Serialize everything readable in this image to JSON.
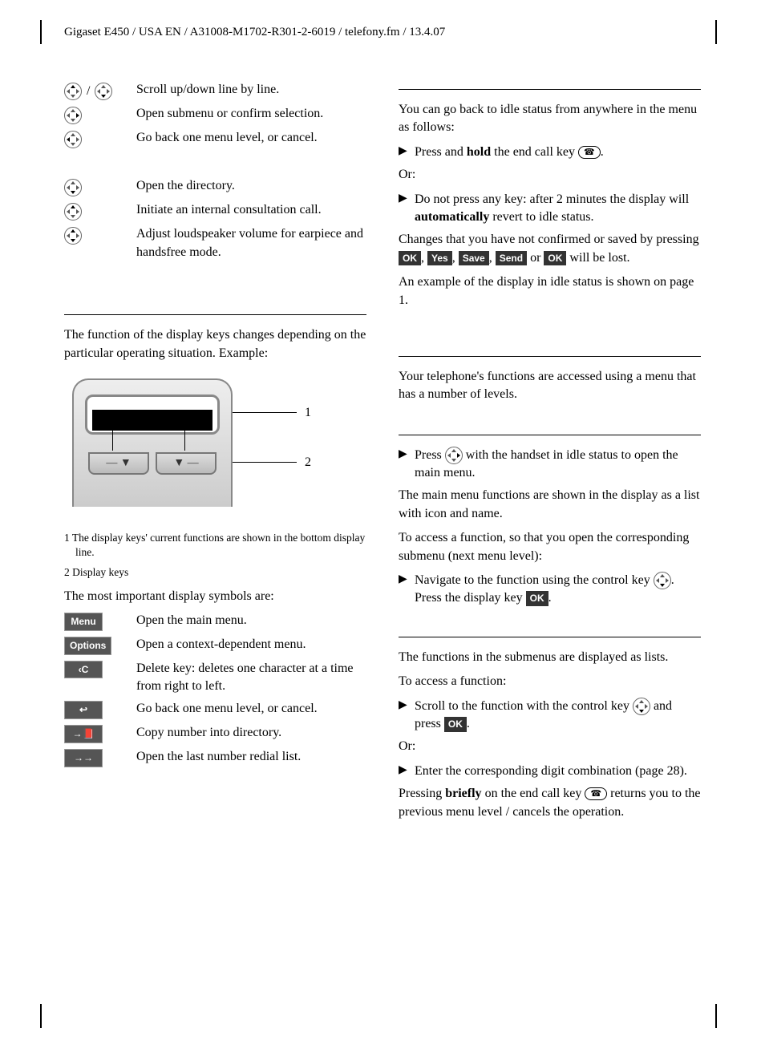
{
  "header": "Gigaset E450 / USA EN / A31008-M1702-R301-2-6019 / telefony.fm / 13.4.07",
  "left": {
    "nav_items": [
      {
        "icon": "up-down",
        "text": "Scroll up/down line by line."
      },
      {
        "icon": "right",
        "text": "Open submenu or confirm selection."
      },
      {
        "icon": "left",
        "text": "Go back one menu level, or cancel."
      },
      {
        "icon": "down",
        "text": "Open the directory."
      },
      {
        "icon": "up",
        "text": "Initiate an internal consultation call."
      },
      {
        "icon": "updown2",
        "text": "Adjust loudspeaker volume for earpiece and handsfree mode."
      }
    ],
    "display_intro": "The function of the display keys changes depending on the particular operating situation. Example:",
    "diagram": {
      "label1": "1",
      "label2": "2"
    },
    "caption1": "1 The display keys' current functions are shown in the bottom display line.",
    "caption2": "2 Display keys",
    "symbols_intro": "The most important display symbols are:",
    "symbols": [
      {
        "label": "Menu",
        "text": "Open the main menu."
      },
      {
        "label": "Options",
        "text": "Open a context-dependent menu."
      },
      {
        "label": "‹C",
        "text": "Delete key: deletes one character at a time from right to left."
      },
      {
        "label": "↩",
        "text": "Go back one menu level, or cancel."
      },
      {
        "label": "→📕",
        "text": "Copy number into directory."
      },
      {
        "label": "→→",
        "text": "Open the last number redial list."
      }
    ]
  },
  "right": {
    "idle_intro": "You can go back to idle status from anywhere in the menu as follows:",
    "idle_b1a": "Press and ",
    "idle_b1b": "hold",
    "idle_b1c": " the end call key ",
    "idle_or": "Or:",
    "idle_b2a": "Do not press any key: after 2 minutes the display will ",
    "idle_b2b": "automatically",
    "idle_b2c": " revert to idle status.",
    "changes_a": "Changes that you have not confirmed or saved by pressing ",
    "changes_b": " will be lost.",
    "badges": {
      "ok": "OK",
      "yes": "Yes",
      "save": "Save",
      "send": "Send"
    },
    "example_ref": "An example of the display in idle status is shown on page 1.",
    "menu_intro": "Your telephone's functions are accessed using a menu that has a number of levels.",
    "main_b1": "Press      with the handset in idle status to open the main menu.",
    "main_p1": "The main menu functions are shown in the display as a list with icon and name.",
    "main_p2": "To access a function, so that you open the corresponding submenu (next menu level):",
    "main_b2a": "Navigate to the function using the control key ",
    "main_b2b": ". Press the display key ",
    "sub_intro": "The functions in the submenus are displayed as lists.",
    "sub_access": "To access a function:",
    "sub_b1a": "Scroll to the function with the control key ",
    "sub_b1b": " and press ",
    "sub_or": "Or:",
    "sub_b2": "Enter the corresponding digit combination (page 28).",
    "sub_press_a": "Pressing ",
    "sub_press_b": "briefly",
    "sub_press_c": " on the end call key ",
    "sub_press_d": " returns you to the previous menu level / cancels the operation."
  }
}
